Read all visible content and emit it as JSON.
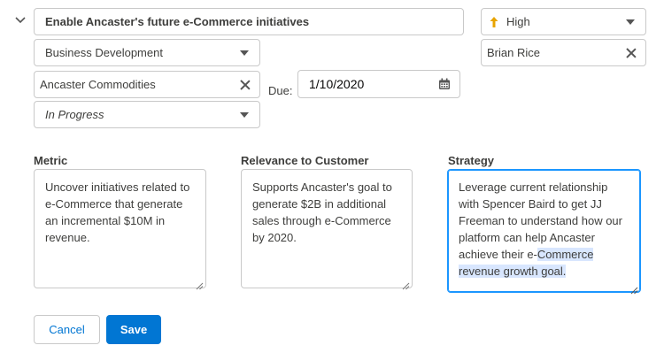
{
  "task": {
    "title": "Enable Ancaster's future e-Commerce initiatives",
    "priority": "High",
    "category": "Business Development",
    "owner": "Brian Rice",
    "account": "Ancaster Commodities",
    "due_label": "Due:",
    "due_date": "1/10/2020",
    "status": "In Progress"
  },
  "sections": {
    "metric": {
      "label": "Metric",
      "text": "Uncover initiatives related to e-Commerce that generate an incremental $10M in revenue."
    },
    "relevance": {
      "label": "Relevance to Customer",
      "text": "Supports Ancaster's goal to generate $2B in additional sales through e-Commerce by 2020."
    },
    "strategy": {
      "label": "Strategy",
      "text_plain": "Leverage current relationship with Spencer Baird to get JJ Freeman to understand how our platform can help Ancaster achieve their e-",
      "text_highlighted": "Commerce revenue growth goal."
    }
  },
  "buttons": {
    "cancel": "Cancel",
    "save": "Save"
  },
  "colors": {
    "accent": "#0176d3",
    "priority_arrow": "#e8a400",
    "focus_border": "#1b96ff",
    "selection": "#d8e6fe"
  },
  "icons": {
    "collapse": "chevron-down-icon",
    "priority": "arrow-up-icon",
    "calendar": "calendar-icon",
    "clear": "close-icon",
    "dropdown": "caret-down-icon"
  }
}
